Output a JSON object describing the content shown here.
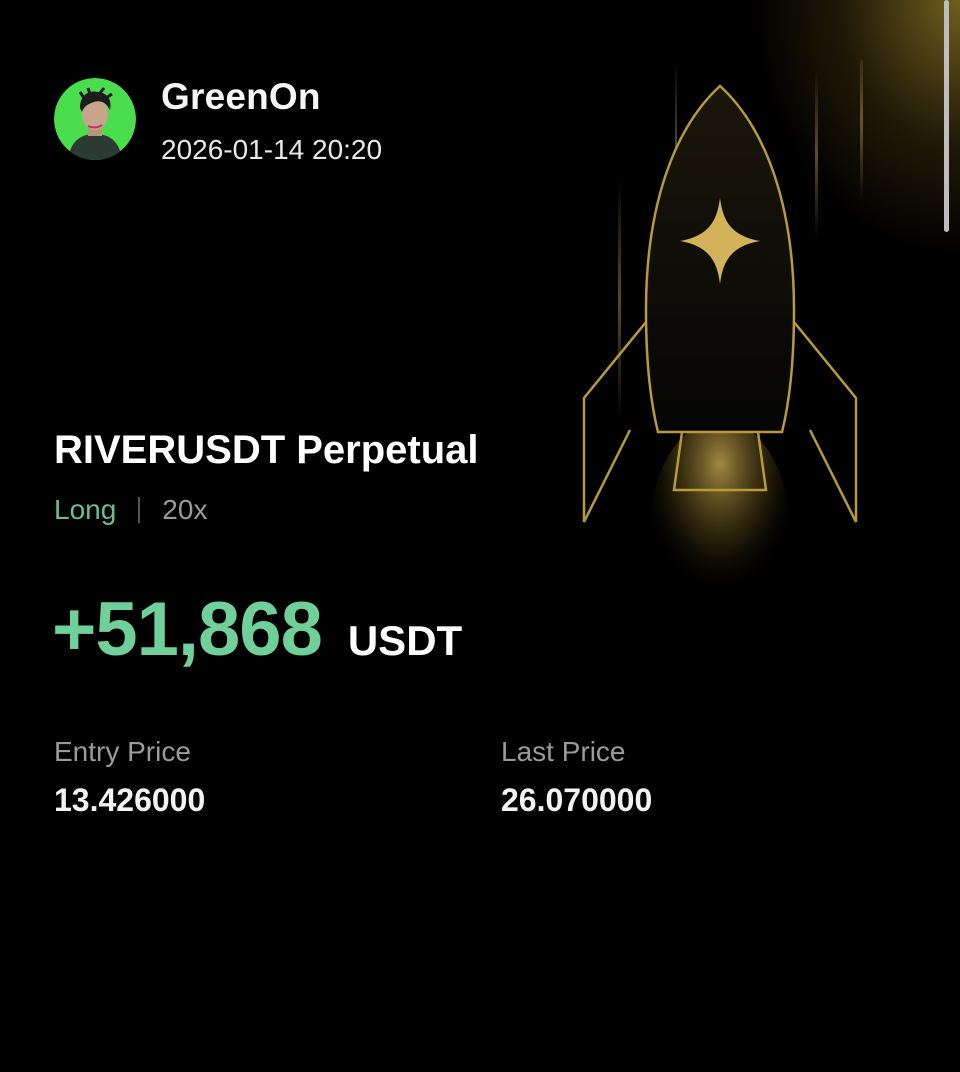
{
  "user": {
    "name": "GreenOn",
    "timestamp": "2026-01-14 20:20",
    "avatar_icon": "user-avatar"
  },
  "position": {
    "pair": "RIVERUSDT Perpetual",
    "direction": "Long",
    "leverage": "20x"
  },
  "pnl": {
    "value": "+51,868",
    "unit": "USDT"
  },
  "stats": {
    "entry_label": "Entry Price",
    "entry_value": "13.426000",
    "last_label": "Last Price",
    "last_value": "26.070000"
  },
  "colors": {
    "background": "#000000",
    "profit_green": "#6fd09a",
    "direction_green": "#6bbf8c",
    "rocket_gold": "#b89a3a"
  },
  "icons": {
    "decoration": "rocket-icon"
  }
}
